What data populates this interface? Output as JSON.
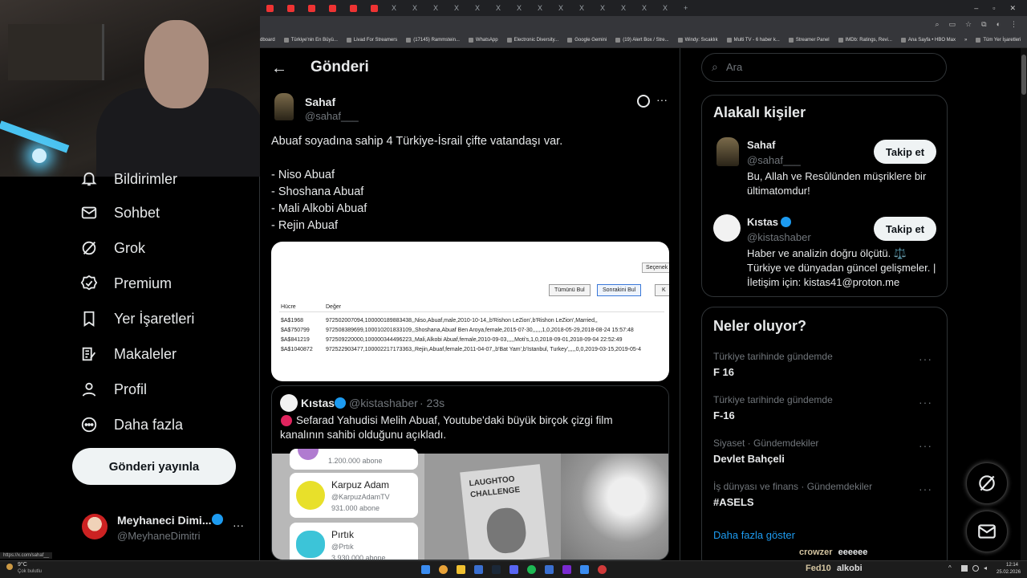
{
  "browser": {
    "tab_glyph": "X",
    "bookmarks": [
      "dboard",
      "Türkiye'nin En Büyü...",
      "Livad For Streamers",
      "(17145) Rammstein...",
      "WhatsApp",
      "Electronic Diversity...",
      "Google Gemini",
      "(19) Alert Box / Stre...",
      "Windy: Sıcaklık",
      "Multi TV - 6 haber k...",
      "Streamer Panel",
      "IMDb: Ratings, Revi...",
      "Ana Sayfa • HBO Max",
      "»",
      "Tüm Yer İşaretleri"
    ]
  },
  "sidebar": {
    "items": [
      {
        "label": "Bildirimler",
        "icon": "bell-icon"
      },
      {
        "label": "Sohbet",
        "icon": "mail-icon"
      },
      {
        "label": "Grok",
        "icon": "grok-icon"
      },
      {
        "label": "Premium",
        "icon": "verified-icon"
      },
      {
        "label": "Yer İşaretleri",
        "icon": "bookmark-icon"
      },
      {
        "label": "Makaleler",
        "icon": "article-icon"
      },
      {
        "label": "Profil",
        "icon": "profile-icon"
      },
      {
        "label": "Daha fazla",
        "icon": "more-icon"
      }
    ],
    "post_button": "Gönderi yayınla",
    "profile": {
      "name": "Meyhaneci Dimi...",
      "handle": "@MeyhaneDimitri",
      "more": "···"
    }
  },
  "main": {
    "header_title": "Gönderi",
    "author": {
      "name": "Sahaf",
      "handle": "@sahaf___"
    },
    "more": "···",
    "tweet_lines": [
      "Abuaf soyadına sahip 4 Türkiye-İsrail çifte vatandaşı var.",
      "- Niso Abuaf",
      "- Shoshana Abuaf",
      "- Mali Alkobi Abuaf",
      "- Rejin Abuaf"
    ],
    "excel": {
      "btn_options": "Seçenek",
      "btn_find_all": "Tümünü Bul",
      "btn_find_next": "Sonrakini Bul",
      "btn_close": "K",
      "col_cell": "Hücre",
      "col_value": "Değer",
      "rows": [
        {
          "cell": "$A$1968",
          "value": "972502007094,100000189883438,,Niso,Abuaf,male,2010-10-14,,b'Rishon LeZion',b'Rishon LeZion',Married,,"
        },
        {
          "cell": "$A$750799",
          "value": "972508389699,100010201833109,,Shoshana,Abuaf Ben Aroya,female,2015-07-30,,,,,,1,0,2018-05-29,2018-08-24 15:57:48"
        },
        {
          "cell": "$A$841219",
          "value": "972509220000,100000344496223,,Mali,Alkobi Abuaf,female,2010-09-03,,,,,Moti's,1,0,2018-09-01,2018-09-04 22:52:49"
        },
        {
          "cell": "$A$1040872",
          "value": "972522903477,100002217173363,,Rejin,Abuaf,female,2011-04-07,,b'Bat Yam',b'Istanbul, Turkey',,,,,0,0,2019-03-15,2019-05-4"
        }
      ]
    },
    "quote": {
      "name": "Kıstas",
      "handle": "@kistashaber",
      "time": "· 23s",
      "text": "Sefarad Yahudisi Melih Abuaf, Youtube'daki büyük birçok çizgi film kanalının sahibi olduğunu açıkladı.",
      "channels": [
        {
          "title": "",
          "sub": "1.200.000 abone",
          "handle": ""
        },
        {
          "title": "Karpuz Adam",
          "handle": "@KarpuzAdamTV",
          "sub": "931.000 abone"
        },
        {
          "title": "Pırtık",
          "handle": "@Prtık",
          "sub": "3.930.000 abone"
        }
      ],
      "image_text_1": "LAUGHTOO",
      "image_text_2": "CHALLENGE"
    }
  },
  "right": {
    "search_placeholder": "Ara",
    "related_title": "Alakalı kişiler",
    "people": [
      {
        "name": "Sahaf",
        "handle": "@sahaf___",
        "bio": "Bu, Allah ve Resûlünden müşriklere bir ültimatomdur!",
        "follow": "Takip et"
      },
      {
        "name": "Kıstas",
        "handle": "@kistashaber",
        "bio": "Haber ve analizin doğru ölçütü. ⚖️ Türkiye ve dünyadan güncel gelişmeler. | İletişim için: kistas41@proton.me",
        "follow": "Takip et"
      }
    ],
    "trends_title": "Neler oluyor?",
    "trends": [
      {
        "category": "Türkiye tarihinde gündemde",
        "name": "F 16"
      },
      {
        "category": "Türkiye tarihinde gündemde",
        "name": "F-16"
      },
      {
        "category": "Siyaset · Gündemdekiler",
        "name": "Devlet Bahçeli"
      },
      {
        "category": "İş dünyası ve finans · Gündemdekiler",
        "name": "#ASELS"
      }
    ],
    "show_more": "Daha fazla göster"
  },
  "chat": [
    {
      "user": "crowzer",
      "msg": "eeeeee"
    },
    {
      "user": "Fed10",
      "msg": "alkobi"
    }
  ],
  "status_url": "https://x.com/sahaf__",
  "taskbar": {
    "weather_temp": "9°C",
    "weather_desc": "Çok bulutlu",
    "time": "12:14",
    "date": "25.02.2026"
  },
  "colors": {
    "verified": "#1d9bf0",
    "link": "#1d9bf0",
    "chat_user": "#d3c4a0"
  }
}
